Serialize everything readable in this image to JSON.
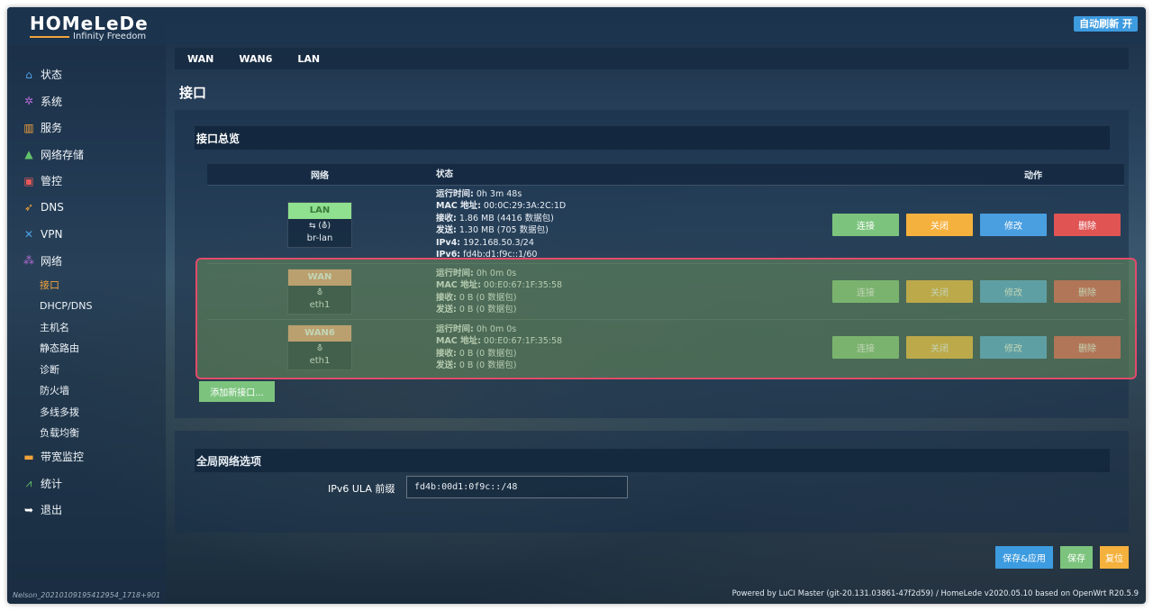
{
  "topbar": {
    "auto_refresh_label": "自动刷新 开"
  },
  "logo": {
    "main": "HOMeLeDe",
    "sub": "Infinity Freedom"
  },
  "sidebar": {
    "items": [
      {
        "label": "状态",
        "icon": "home-icon",
        "color": "#4da3e8"
      },
      {
        "label": "系统",
        "icon": "gear-icon",
        "color": "#b46ad6"
      },
      {
        "label": "服务",
        "icon": "map-icon",
        "color": "#f2a23a"
      },
      {
        "label": "网络存储",
        "icon": "storage-icon",
        "color": "#62c36a"
      },
      {
        "label": "管控",
        "icon": "control-icon",
        "color": "#e85a5a"
      },
      {
        "label": "DNS",
        "icon": "rocket-icon",
        "color": "#f2a23a"
      },
      {
        "label": "VPN",
        "icon": "vpn-icon",
        "color": "#4da3e8"
      },
      {
        "label": "网络",
        "icon": "network-icon",
        "color": "#b46ad6"
      }
    ],
    "network_sub": [
      "接口",
      "DHCP/DNS",
      "主机名",
      "静态路由",
      "诊断",
      "防火墙",
      "多线多拨",
      "负载均衡"
    ],
    "after_items": [
      {
        "label": "带宽监控",
        "icon": "briefcase-icon",
        "color": "#f2a23a"
      },
      {
        "label": "统计",
        "icon": "chart-icon",
        "color": "#62c36a"
      },
      {
        "label": "退出",
        "icon": "logout-icon",
        "color": "#ffffff"
      }
    ],
    "footer_id": "Nelson_20210109195412954_1718+901"
  },
  "tabs": [
    "WAN",
    "WAN6",
    "LAN"
  ],
  "page_title": "接口",
  "overview": {
    "title": "接口总览",
    "headers": {
      "network": "网络",
      "status": "状态",
      "actions": "动作"
    },
    "rows": [
      {
        "name": "LAN",
        "badge_color": "#8fe08f",
        "badge_text_color": "#3a7a3a",
        "iface_icons": "⇆ (⛢)",
        "device": "br-lan",
        "status": [
          [
            "运行时间:",
            "0h 3m 48s"
          ],
          [
            "MAC 地址:",
            "00:0C:29:3A:2C:1D"
          ],
          [
            "接收:",
            "1.86 MB (4416 数据包)"
          ],
          [
            "发送:",
            "1.30 MB (705 数据包)"
          ],
          [
            "IPv4:",
            "192.168.50.3/24"
          ],
          [
            "IPv6:",
            "fd4b:d1:f9c::1/60"
          ]
        ]
      },
      {
        "name": "WAN",
        "badge_color": "#f0a080",
        "badge_text_color": "#ffffff",
        "iface_icons": "⛢",
        "device": "eth1",
        "status": [
          [
            "运行时间:",
            "0h 0m 0s"
          ],
          [
            "MAC 地址:",
            "00:E0:67:1F:35:58"
          ],
          [
            "接收:",
            "0 B (0 数据包)"
          ],
          [
            "发送:",
            "0 B (0 数据包)"
          ]
        ]
      },
      {
        "name": "WAN6",
        "badge_color": "#f0a080",
        "badge_text_color": "#ffffff",
        "iface_icons": "⛢",
        "device": "eth1",
        "status": [
          [
            "运行时间:",
            "0h 0m 0s"
          ],
          [
            "MAC 地址:",
            "00:E0:67:1F:35:58"
          ],
          [
            "接收:",
            "0 B (0 数据包)"
          ],
          [
            "发送:",
            "0 B (0 数据包)"
          ]
        ]
      }
    ],
    "buttons": {
      "connect": "连接",
      "stop": "关闭",
      "edit": "修改",
      "delete": "删除"
    },
    "add_label": "添加新接口..."
  },
  "global": {
    "title": "全局网络选项",
    "ula_label": "IPv6 ULA 前缀",
    "ula_value": "fd4b:00d1:0f9c::/48"
  },
  "bottom": {
    "apply": "保存&应用",
    "save": "保存",
    "reset": "复位"
  },
  "powered": "Powered by LuCI Master (git-20.131.03861-47f2d59) / HomeLede v2020.05.10 based on OpenWrt R20.5.9"
}
